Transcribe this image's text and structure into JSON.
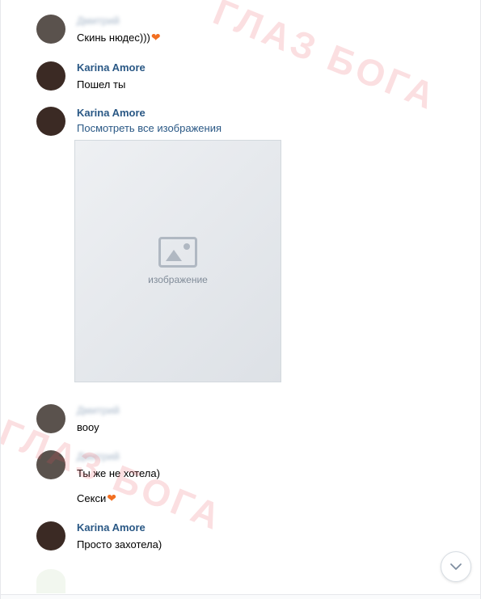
{
  "watermark": {
    "text_1": "ГЛАЗ БОГА",
    "text_2": "ГЛАЗ БОГА"
  },
  "messages": [
    {
      "sender": "Дмитрий",
      "sender_blurred": true,
      "lines": [
        "Скинь нюдес)))"
      ],
      "heart": true
    },
    {
      "sender": "Karina Amore",
      "sender_blurred": false,
      "lines": [
        "Пошел ты"
      ]
    },
    {
      "sender": "Karina Amore",
      "sender_blurred": false,
      "link": "Посмотреть все изображения",
      "attachment": "изображение"
    },
    {
      "sender": "Дмитрий",
      "sender_blurred": true,
      "lines": [
        "вооу"
      ]
    },
    {
      "sender": "Дмитрий",
      "sender_blurred": true,
      "lines": [
        "Ты же не хотела)",
        "Секси"
      ],
      "heart_on_line": 1
    },
    {
      "sender": "Karina Amore",
      "sender_blurred": false,
      "lines": [
        "Просто захотела)"
      ]
    }
  ],
  "icons": {
    "heart": "heart-icon",
    "scroll": "chevron-down-icon"
  },
  "colors": {
    "link": "#2a5885",
    "heart": "#f26f21",
    "watermark": "#e8505a"
  }
}
